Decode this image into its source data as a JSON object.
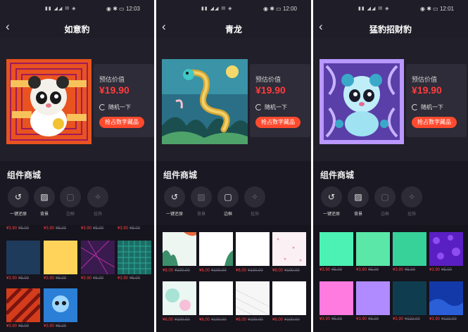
{
  "status_bar": {
    "signals": "▮▮ ◢◢ ✉ ◈",
    "screens": [
      {
        "icons": "◉ ✱ ▭",
        "time": "12:03"
      },
      {
        "icons": "◉ ✱ ▭",
        "time": "12:00"
      },
      {
        "icons": "◉ ✱ ▭",
        "time": "12:01"
      }
    ]
  },
  "screens": [
    {
      "title": "如意豹",
      "price_label": "预估价值",
      "price": "¥19.90",
      "random_label": "随机一下",
      "cta_label": "抢占数字藏品",
      "section_title": "组件商城",
      "tools": [
        {
          "glyph": "↺",
          "label": "一键还原",
          "active": true,
          "icon": "reset-icon"
        },
        {
          "glyph": "▨",
          "label": "背景",
          "active": true,
          "icon": "background-icon"
        },
        {
          "glyph": "▢",
          "label": "边框",
          "active": false,
          "icon": "frame-icon"
        },
        {
          "glyph": "✧",
          "label": "挂饰",
          "active": false,
          "icon": "pendant-icon"
        }
      ],
      "tiles": [
        {
          "price": "¥3.90",
          "orig": "¥5.00",
          "color": "#1e3b5c"
        },
        {
          "price": "¥3.90",
          "orig": "¥5.00",
          "color": "#ffd35a"
        },
        {
          "price": "¥3.90",
          "orig": "¥5.00",
          "color": "#3a1b4f"
        },
        {
          "price": "¥3.90",
          "orig": "¥5.00",
          "color": "#1b6d64"
        },
        {
          "price": "¥3.90",
          "orig": "¥5.00",
          "color": "#d43d1c"
        },
        {
          "price": "¥3.90",
          "orig": "¥5.00",
          "color": "#2b7fd6"
        }
      ]
    },
    {
      "title": "青龙",
      "price_label": "预估价值",
      "price": "¥19.90",
      "random_label": "随机一下",
      "cta_label": "抢占数字藏品",
      "section_title": "组件商城",
      "tools": [
        {
          "glyph": "↺",
          "label": "一键还原",
          "active": true,
          "icon": "reset-icon"
        },
        {
          "glyph": "▨",
          "label": "背景",
          "active": false,
          "icon": "background-icon"
        },
        {
          "glyph": "▢",
          "label": "边框",
          "active": true,
          "icon": "frame-icon"
        },
        {
          "glyph": "✧",
          "label": "挂饰",
          "active": false,
          "icon": "pendant-icon"
        }
      ],
      "tiles": [
        {
          "price": "¥8.00",
          "orig": "¥100.00",
          "color": "#eef6f1"
        },
        {
          "price": "¥6.00",
          "orig": "¥100.00",
          "color": "#ffffff"
        },
        {
          "price": "¥6.00",
          "orig": "¥100.00",
          "color": "#ffffff"
        },
        {
          "price": "¥8.00",
          "orig": "¥100.00",
          "color": "#fbf1f4"
        },
        {
          "price": "¥6.00",
          "orig": "¥100.00",
          "color": "#eaf7f2"
        },
        {
          "price": "¥6.00",
          "orig": "¥100.00",
          "color": "#ffffff"
        },
        {
          "price": "¥6.00",
          "orig": "¥100.00",
          "color": "#f6f6f6"
        },
        {
          "price": "¥6.00",
          "orig": "¥100.00",
          "color": "#ffffff"
        }
      ]
    },
    {
      "title": "猛豹招财豹",
      "price_label": "预估价值",
      "price": "¥19.90",
      "random_label": "随机一下",
      "cta_label": "抢占数字藏品",
      "section_title": "组件商城",
      "tools": [
        {
          "glyph": "↺",
          "label": "一键还原",
          "active": true,
          "icon": "reset-icon"
        },
        {
          "glyph": "▨",
          "label": "背景",
          "active": true,
          "icon": "background-icon"
        },
        {
          "glyph": "▢",
          "label": "边框",
          "active": false,
          "icon": "frame-icon"
        },
        {
          "glyph": "✧",
          "label": "挂饰",
          "active": false,
          "icon": "pendant-icon"
        }
      ],
      "tiles": [
        {
          "price": "¥3.90",
          "orig": "¥5.00",
          "color": "#4cf2b4"
        },
        {
          "price": "¥3.90",
          "orig": "¥5.00",
          "color": "#5ae7a7"
        },
        {
          "price": "¥3.90",
          "orig": "¥5.00",
          "color": "#36d29a"
        },
        {
          "price": "¥3.90",
          "orig": "¥5.00",
          "color": "#5a1fc2"
        },
        {
          "price": "¥3.90",
          "orig": "¥5.00",
          "color": "#ff7be0"
        },
        {
          "price": "¥3.90",
          "orig": "¥5.00",
          "color": "#b08bff"
        },
        {
          "price": "¥3.90",
          "orig": "¥122.00",
          "color": "#0f3d4f"
        },
        {
          "price": "¥3.90",
          "orig": "¥122.00",
          "color": "#1339a8"
        }
      ]
    }
  ],
  "colors": {
    "accent": "#ff4a2e",
    "price": "#ff3d3d",
    "background": "#1a1822"
  }
}
